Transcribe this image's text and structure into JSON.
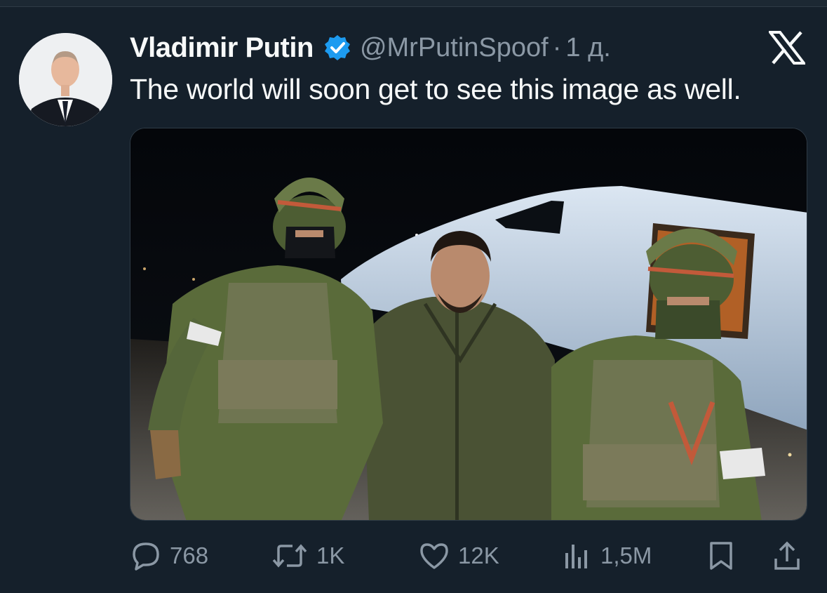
{
  "tweet": {
    "display_name": "Vladimir Putin",
    "handle": "@MrPutinSpoof",
    "separator": "·",
    "time": "1 д.",
    "text": "The world will soon get to see this image as well.",
    "verified": true
  },
  "actions": {
    "replies": "768",
    "retweets": "1K",
    "likes": "12K",
    "views": "1,5M"
  },
  "icons": {
    "reply": "reply-icon",
    "retweet": "retweet-icon",
    "like": "like-icon",
    "views": "views-icon",
    "bookmark": "bookmark-icon",
    "share": "share-icon",
    "brand": "x-logo-icon"
  },
  "colors": {
    "background": "#15202b",
    "text": "#f7f9f9",
    "muted": "#8b98a5",
    "verified": "#1d9bf0"
  }
}
